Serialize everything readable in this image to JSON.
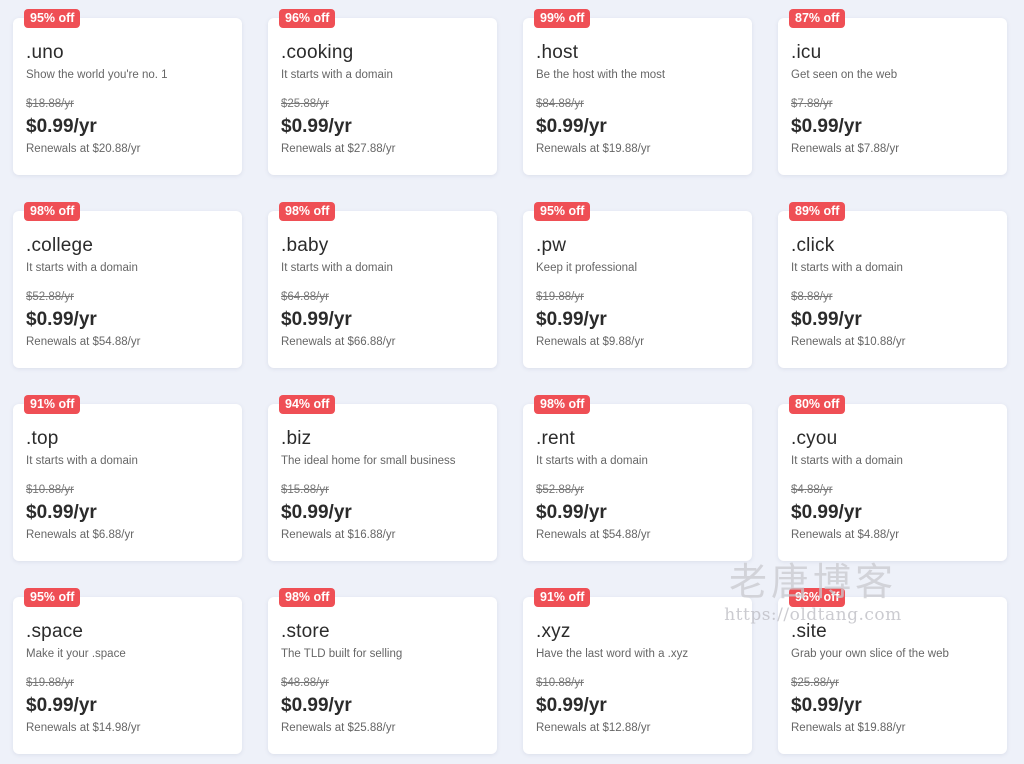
{
  "cards": [
    {
      "badge": "95% off",
      "tld": ".uno",
      "tagline": "Show the world you're no. 1",
      "old_price": "$18.88/yr",
      "price": "$0.99/yr",
      "renewal": "Renewals at $20.88/yr"
    },
    {
      "badge": "96% off",
      "tld": ".cooking",
      "tagline": "It starts with a domain",
      "old_price": "$25.88/yr",
      "price": "$0.99/yr",
      "renewal": "Renewals at $27.88/yr"
    },
    {
      "badge": "99% off",
      "tld": ".host",
      "tagline": "Be the host with the most",
      "old_price": "$84.88/yr",
      "price": "$0.99/yr",
      "renewal": "Renewals at $19.88/yr"
    },
    {
      "badge": "87% off",
      "tld": ".icu",
      "tagline": "Get seen on the web",
      "old_price": "$7.88/yr",
      "price": "$0.99/yr",
      "renewal": "Renewals at $7.88/yr"
    },
    {
      "badge": "98% off",
      "tld": ".college",
      "tagline": "It starts with a domain",
      "old_price": "$52.88/yr",
      "price": "$0.99/yr",
      "renewal": "Renewals at $54.88/yr"
    },
    {
      "badge": "98% off",
      "tld": ".baby",
      "tagline": "It starts with a domain",
      "old_price": "$64.88/yr",
      "price": "$0.99/yr",
      "renewal": "Renewals at $66.88/yr"
    },
    {
      "badge": "95% off",
      "tld": ".pw",
      "tagline": "Keep it professional",
      "old_price": "$19.88/yr",
      "price": "$0.99/yr",
      "renewal": "Renewals at $9.88/yr"
    },
    {
      "badge": "89% off",
      "tld": ".click",
      "tagline": "It starts with a domain",
      "old_price": "$8.88/yr",
      "price": "$0.99/yr",
      "renewal": "Renewals at $10.88/yr"
    },
    {
      "badge": "91% off",
      "tld": ".top",
      "tagline": "It starts with a domain",
      "old_price": "$10.88/yr",
      "price": "$0.99/yr",
      "renewal": "Renewals at $6.88/yr"
    },
    {
      "badge": "94% off",
      "tld": ".biz",
      "tagline": "The ideal home for small business",
      "old_price": "$15.88/yr",
      "price": "$0.99/yr",
      "renewal": "Renewals at $16.88/yr"
    },
    {
      "badge": "98% off",
      "tld": ".rent",
      "tagline": "It starts with a domain",
      "old_price": "$52.88/yr",
      "price": "$0.99/yr",
      "renewal": "Renewals at $54.88/yr"
    },
    {
      "badge": "80% off",
      "tld": ".cyou",
      "tagline": "It starts with a domain",
      "old_price": "$4.88/yr",
      "price": "$0.99/yr",
      "renewal": "Renewals at $4.88/yr"
    },
    {
      "badge": "95% off",
      "tld": ".space",
      "tagline": "Make it your .space",
      "old_price": "$19.88/yr",
      "price": "$0.99/yr",
      "renewal": "Renewals at $14.98/yr"
    },
    {
      "badge": "98% off",
      "tld": ".store",
      "tagline": "The TLD built for selling",
      "old_price": "$48.88/yr",
      "price": "$0.99/yr",
      "renewal": "Renewals at $25.88/yr"
    },
    {
      "badge": "91% off",
      "tld": ".xyz",
      "tagline": "Have the last word with a .xyz",
      "old_price": "$10.88/yr",
      "price": "$0.99/yr",
      "renewal": "Renewals at $12.88/yr"
    },
    {
      "badge": "96% off",
      "tld": ".site",
      "tagline": "Grab your own slice of the web",
      "old_price": "$25.88/yr",
      "price": "$0.99/yr",
      "renewal": "Renewals at $19.88/yr"
    }
  ],
  "watermark": {
    "title": "老唐博客",
    "url": "https://oldtang.com"
  },
  "colors": {
    "page_background": "#eef1f9",
    "badge": "#ef4f55",
    "card": "#ffffff",
    "text_primary": "#2b2b2b",
    "text_secondary": "#666666"
  }
}
